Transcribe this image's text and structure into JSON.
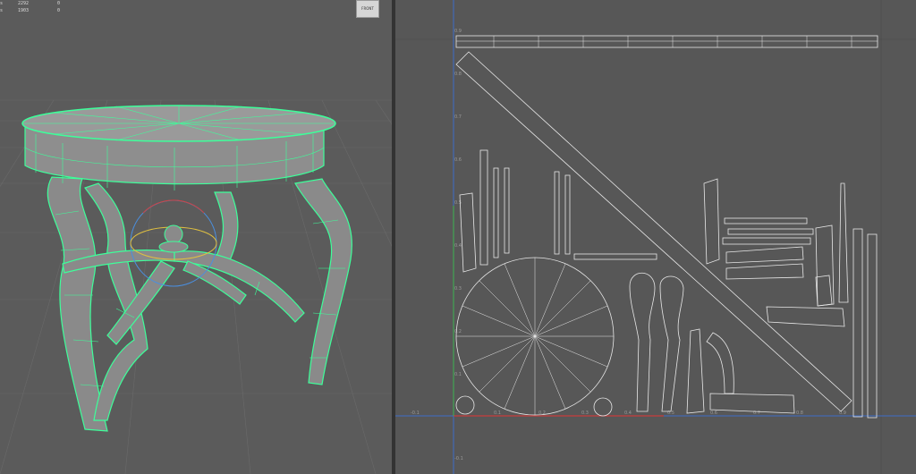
{
  "stats": {
    "rows": [
      {
        "label": "",
        "a": "",
        "b": ""
      },
      {
        "label": "s",
        "a": "2292",
        "b": "0"
      },
      {
        "label": "s",
        "a": "1903",
        "b": "0"
      }
    ]
  },
  "viewcube": {
    "label": "FRONT"
  },
  "uv_editor": {
    "v_ticks": [
      "0.9",
      "0.8",
      "0.7",
      "0.6",
      "0.5",
      "0.4",
      "0.3",
      "0.2",
      "0.1",
      "-0.1"
    ],
    "u_ticks": [
      "-0.1",
      "0.1",
      "0.2",
      "0.3",
      "0.4",
      "0.5",
      "0.6",
      "0.7",
      "0.8",
      "0.9"
    ]
  },
  "colors": {
    "wire_selected": "#3dff9a",
    "uv_shell": "#e8e8e8",
    "axis_u": "#c83c3c",
    "axis_v": "#3c6cc8"
  }
}
